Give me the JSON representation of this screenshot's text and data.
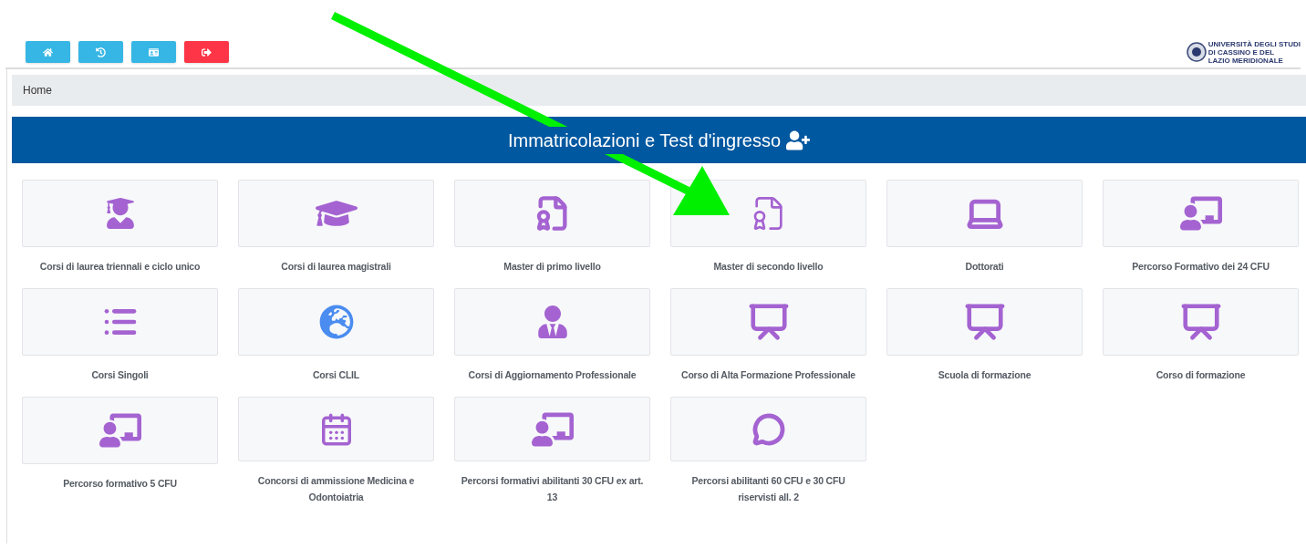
{
  "toolbar": [
    {
      "kind": "home"
    },
    {
      "kind": "history"
    },
    {
      "kind": "card"
    },
    {
      "kind": "logout"
    }
  ],
  "logo": {
    "lines": [
      "UNIVERSITÀ DEGLI STUDI",
      "DI CASSINO E DEL",
      "LAZIO MERIDIONALE"
    ]
  },
  "breadcrumb": "Home",
  "panel": {
    "title": "Immatricolazioni e Test d'ingresso",
    "cards": [
      {
        "kind": "graduate",
        "label": "Corsi di laurea triennali e ciclo unico"
      },
      {
        "kind": "cap",
        "label": "Corsi di laurea magistrali"
      },
      {
        "kind": "certificate-solid",
        "label": "Master di primo livello"
      },
      {
        "kind": "certificate-outline",
        "label": "Master di secondo livello"
      },
      {
        "kind": "laptop",
        "label": "Dottorati"
      },
      {
        "kind": "teacher",
        "label": "Percorso Formativo dei 24 CFU"
      },
      {
        "kind": "list",
        "label": "Corsi Singoli"
      },
      {
        "kind": "globe",
        "label": "Corsi CLIL"
      },
      {
        "kind": "user-tie",
        "label": "Corsi di Aggiornamento Professionale"
      },
      {
        "kind": "presenter",
        "label": "Corso di Alta Formazione Professionale"
      },
      {
        "kind": "presenter",
        "label": "Scuola di formazione"
      },
      {
        "kind": "presenter",
        "label": "Corso di formazione"
      },
      {
        "kind": "teacher",
        "label": "Percorso formativo 5 CFU"
      },
      {
        "kind": "calendar",
        "label": "Concorsi di ammissione Medicina e Odontoiatria"
      },
      {
        "kind": "teacher",
        "label": "Percorsi formativi abilitanti 30 CFU ex art. 13"
      },
      {
        "kind": "chat",
        "label": "Percorsi abilitanti 60 CFU e 30 CFU riservisti all. 2"
      }
    ]
  },
  "annotation": {
    "kind": "arrow"
  }
}
